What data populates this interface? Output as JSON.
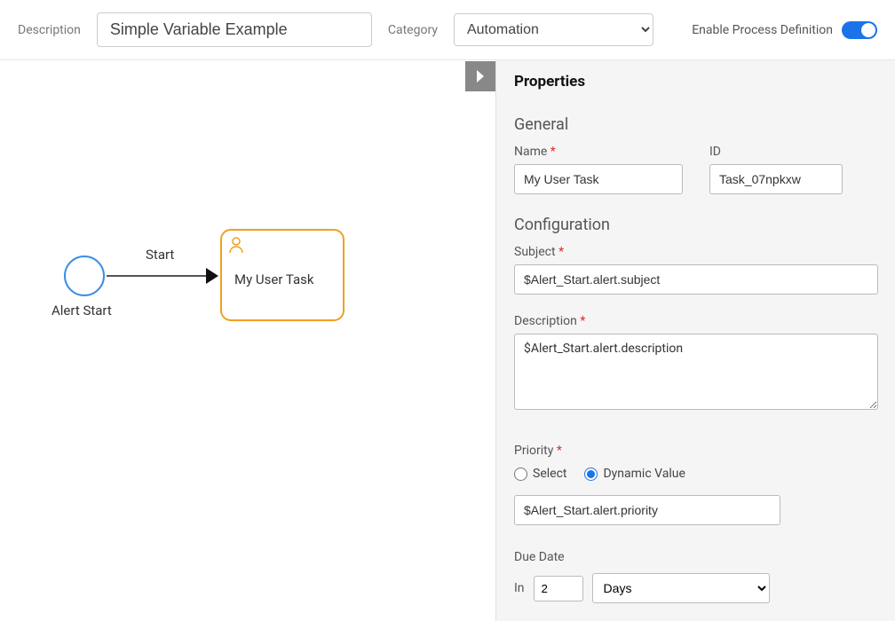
{
  "topbar": {
    "description_label": "Description",
    "description_value": "Simple Variable Example",
    "category_label": "Category",
    "category_value": "Automation",
    "enable_label": "Enable Process Definition"
  },
  "canvas": {
    "start_node_label": "Alert Start",
    "edge_label": "Start",
    "task_label": "My User Task"
  },
  "panel": {
    "title": "Properties",
    "general": {
      "heading": "General",
      "name_label": "Name",
      "name_value": "My User Task",
      "id_label": "ID",
      "id_value": "Task_07npkxw"
    },
    "config": {
      "heading": "Configuration",
      "subject_label": "Subject",
      "subject_value": "$Alert_Start.alert.subject",
      "description_label": "Description",
      "description_value": "$Alert_Start.alert.description",
      "priority_label": "Priority",
      "priority_radio_select": "Select",
      "priority_radio_dynamic": "Dynamic Value",
      "priority_value": "$Alert_Start.alert.priority",
      "due_label": "Due Date",
      "due_in": "In",
      "due_number": "2",
      "due_unit": "Days"
    }
  }
}
